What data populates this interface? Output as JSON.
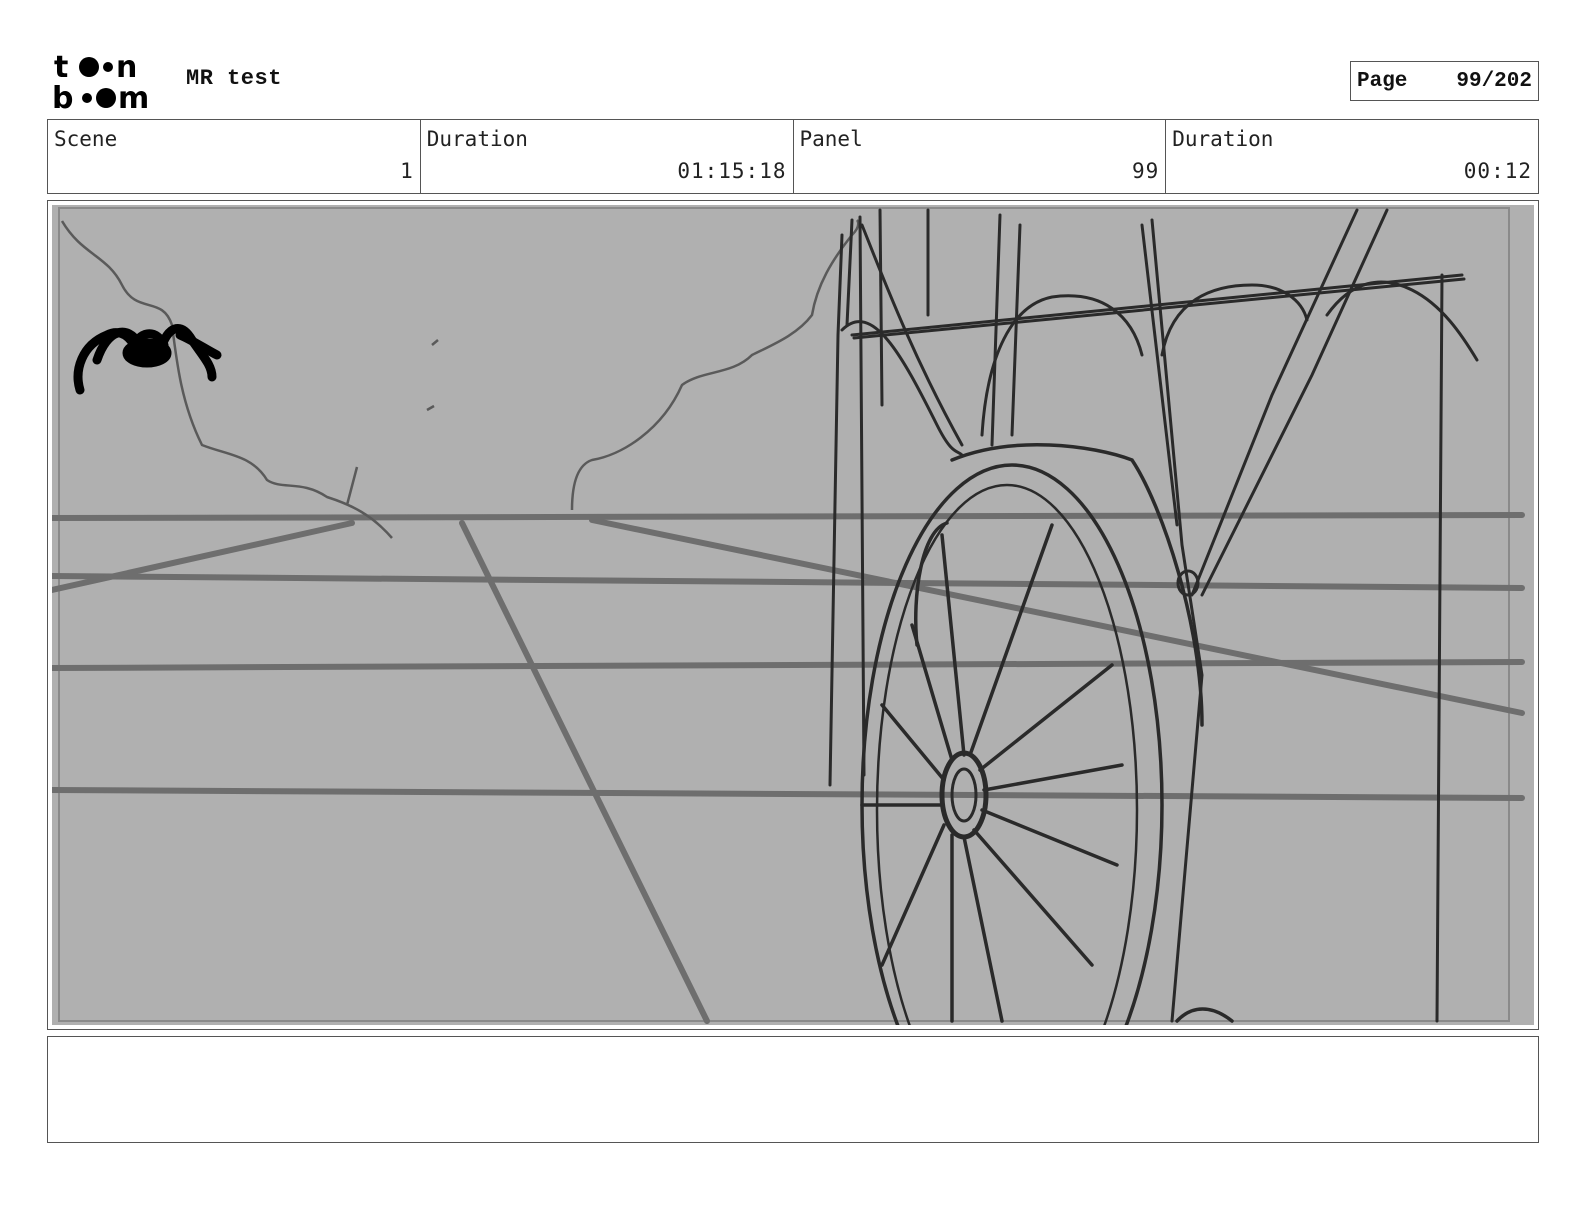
{
  "header": {
    "logo_text": "toon boom",
    "project_title": "MR test",
    "page_label": "Page",
    "page_number": "99/202"
  },
  "info": {
    "scene_label": "Scene",
    "scene_value": "1",
    "scene_duration_label": "Duration",
    "scene_duration_value": "01:15:18",
    "panel_label": "Panel",
    "panel_value": "99",
    "panel_duration_label": "Duration",
    "panel_duration_value": "00:12"
  },
  "panel": {
    "background_color": "#b0b0b0",
    "line_color": "#6e6e6e",
    "sketch_color": "#2a2a2a"
  },
  "notes": {
    "text": ""
  }
}
